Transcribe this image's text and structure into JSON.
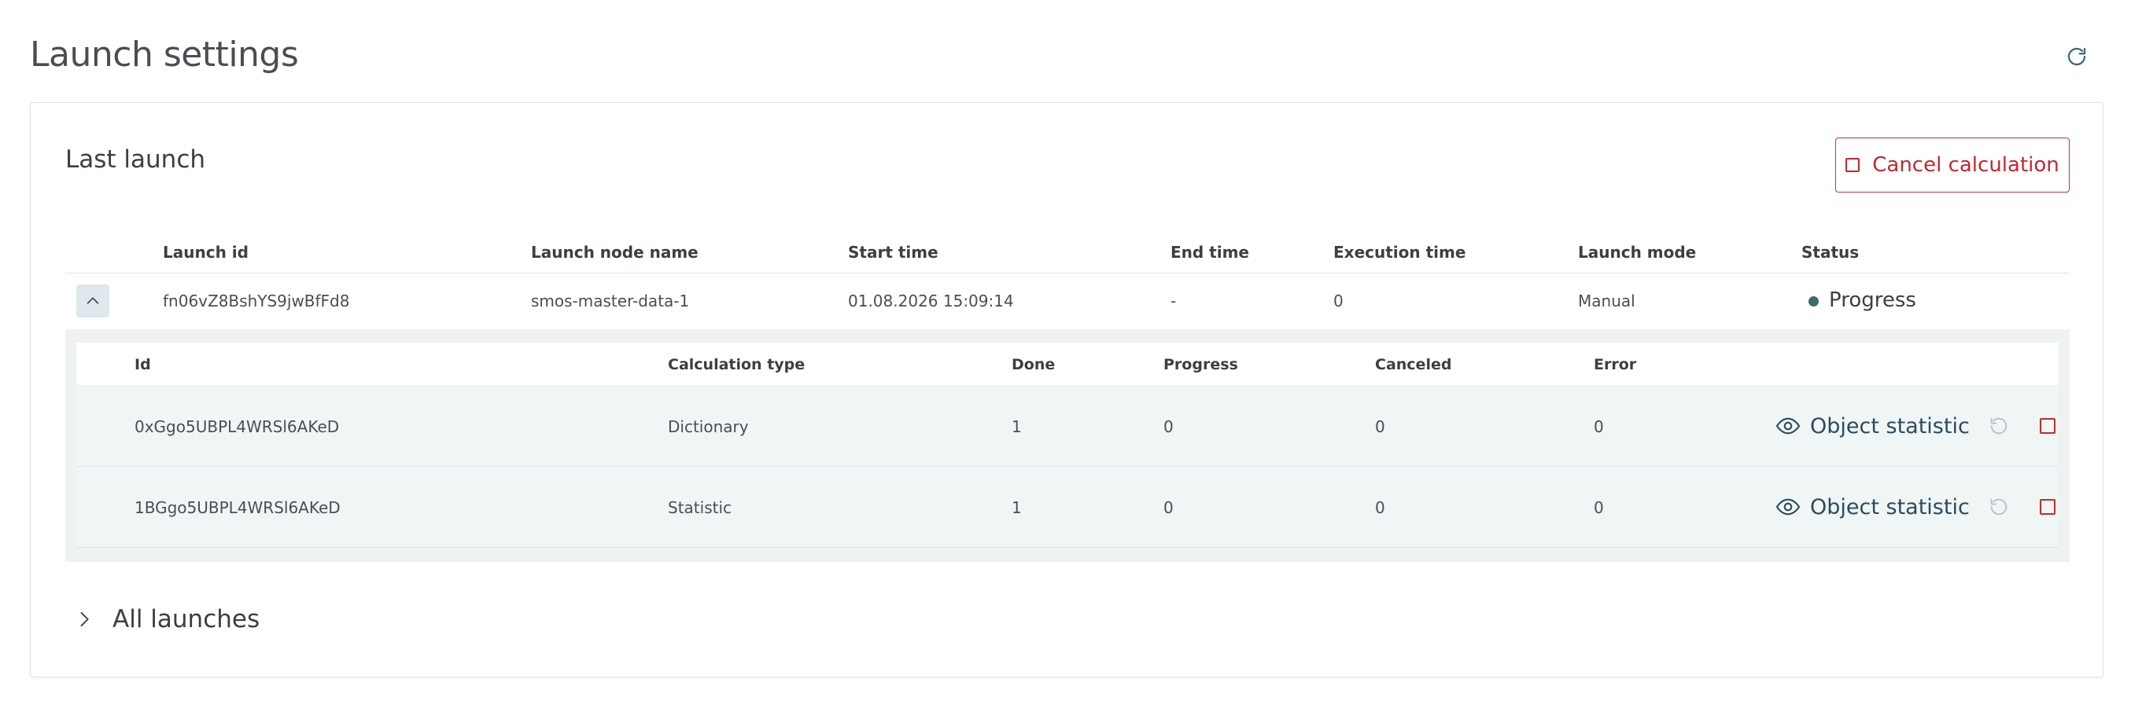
{
  "page": {
    "title": "Launch settings"
  },
  "last_launch": {
    "title": "Last launch",
    "cancel_label": "Cancel calculation",
    "columns": [
      "Launch id",
      "Launch node name",
      "Start time",
      "End time",
      "Execution time",
      "Launch mode",
      "Status"
    ],
    "row": {
      "launch_id": "fn06vZ8BshYS9jwBfFd8",
      "node_name": "smos-master-data-1",
      "start_time": "01.08.2026 15:09:14",
      "end_time": "-",
      "execution_time": "0",
      "launch_mode": "Manual",
      "status": "Progress",
      "status_color": "#3d6b66"
    },
    "sub_columns": [
      "Id",
      "Calculation type",
      "Done",
      "Progress",
      "Canceled",
      "Error"
    ],
    "sub_rows": [
      {
        "id": "0xGgo5UBPL4WRSl6AKeD",
        "type": "Dictionary",
        "done": "1",
        "progress": "0",
        "canceled": "0",
        "error": "0",
        "action_label": "Object statistic"
      },
      {
        "id": "1BGgo5UBPL4WRSl6AKeD",
        "type": "Statistic",
        "done": "1",
        "progress": "0",
        "canceled": "0",
        "error": "0",
        "action_label": "Object statistic"
      }
    ]
  },
  "all_launches": {
    "label": "All launches"
  },
  "colors": {
    "accent": "#2f4a5a",
    "danger": "#c3282f",
    "row_bg": "#eff6f5"
  }
}
